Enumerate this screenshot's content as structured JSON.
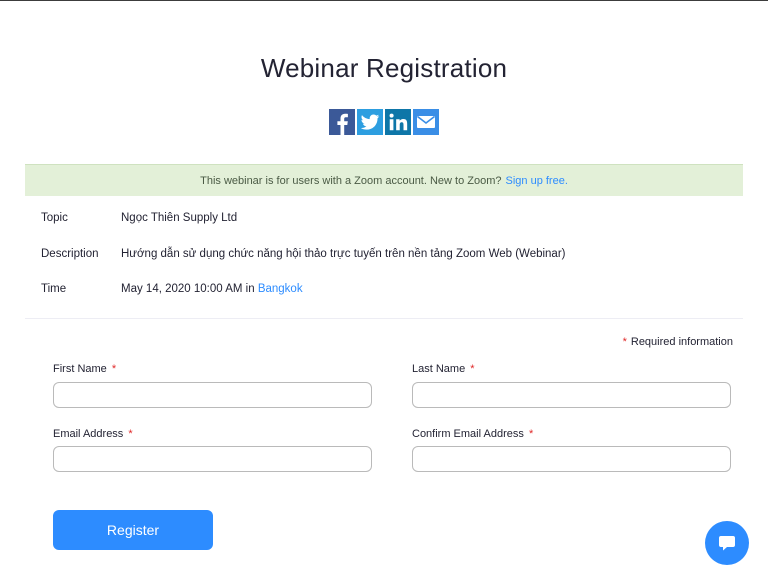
{
  "page": {
    "title": "Webinar Registration"
  },
  "share": [
    {
      "network": "Facebook",
      "icon": "facebook-icon",
      "color": "#3b5998"
    },
    {
      "network": "Twitter",
      "icon": "twitter-icon",
      "color": "#2d9ee0"
    },
    {
      "network": "LinkedIn",
      "icon": "linkedin-icon",
      "color": "#0e76a8"
    },
    {
      "network": "Email",
      "icon": "mail-icon",
      "color": "#3a8ee6"
    }
  ],
  "notice": {
    "text": "This webinar is for users with a Zoom account. New to Zoom?",
    "link": "Sign up free."
  },
  "info": {
    "topic_label": "Topic",
    "topic_value": "Ngọc Thiên Supply Ltd",
    "description_label": "Description",
    "description_value": "Hướng dẫn sử dụng chức năng hội thảo trực tuyến trên nền tảng Zoom Web (Webinar)",
    "time_label": "Time",
    "time_value": "May 14, 2020 10:00 AM in",
    "time_zone_link": "Bangkok"
  },
  "form": {
    "required_star": "*",
    "required_note": "Required information",
    "first_name_label": "First Name",
    "last_name_label": "Last Name",
    "email_label": "Email Address",
    "confirm_email_label": "Confirm Email Address",
    "first_name_value": "",
    "last_name_value": "",
    "email_value": "",
    "confirm_email_value": "",
    "register_label": "Register"
  },
  "chat": {
    "icon": "chat-bubble-icon",
    "color": "#2d8cff"
  }
}
